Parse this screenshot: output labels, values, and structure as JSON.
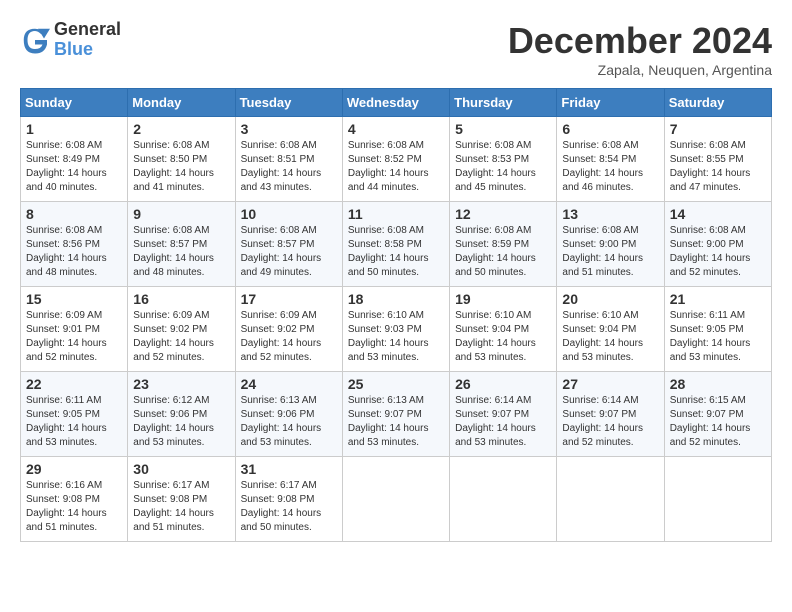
{
  "header": {
    "logo_line1": "General",
    "logo_line2": "Blue",
    "month": "December 2024",
    "location": "Zapala, Neuquen, Argentina"
  },
  "weekdays": [
    "Sunday",
    "Monday",
    "Tuesday",
    "Wednesday",
    "Thursday",
    "Friday",
    "Saturday"
  ],
  "weeks": [
    [
      {
        "day": "1",
        "info": "Sunrise: 6:08 AM\nSunset: 8:49 PM\nDaylight: 14 hours\nand 40 minutes."
      },
      {
        "day": "2",
        "info": "Sunrise: 6:08 AM\nSunset: 8:50 PM\nDaylight: 14 hours\nand 41 minutes."
      },
      {
        "day": "3",
        "info": "Sunrise: 6:08 AM\nSunset: 8:51 PM\nDaylight: 14 hours\nand 43 minutes."
      },
      {
        "day": "4",
        "info": "Sunrise: 6:08 AM\nSunset: 8:52 PM\nDaylight: 14 hours\nand 44 minutes."
      },
      {
        "day": "5",
        "info": "Sunrise: 6:08 AM\nSunset: 8:53 PM\nDaylight: 14 hours\nand 45 minutes."
      },
      {
        "day": "6",
        "info": "Sunrise: 6:08 AM\nSunset: 8:54 PM\nDaylight: 14 hours\nand 46 minutes."
      },
      {
        "day": "7",
        "info": "Sunrise: 6:08 AM\nSunset: 8:55 PM\nDaylight: 14 hours\nand 47 minutes."
      }
    ],
    [
      {
        "day": "8",
        "info": "Sunrise: 6:08 AM\nSunset: 8:56 PM\nDaylight: 14 hours\nand 48 minutes."
      },
      {
        "day": "9",
        "info": "Sunrise: 6:08 AM\nSunset: 8:57 PM\nDaylight: 14 hours\nand 48 minutes."
      },
      {
        "day": "10",
        "info": "Sunrise: 6:08 AM\nSunset: 8:57 PM\nDaylight: 14 hours\nand 49 minutes."
      },
      {
        "day": "11",
        "info": "Sunrise: 6:08 AM\nSunset: 8:58 PM\nDaylight: 14 hours\nand 50 minutes."
      },
      {
        "day": "12",
        "info": "Sunrise: 6:08 AM\nSunset: 8:59 PM\nDaylight: 14 hours\nand 50 minutes."
      },
      {
        "day": "13",
        "info": "Sunrise: 6:08 AM\nSunset: 9:00 PM\nDaylight: 14 hours\nand 51 minutes."
      },
      {
        "day": "14",
        "info": "Sunrise: 6:08 AM\nSunset: 9:00 PM\nDaylight: 14 hours\nand 52 minutes."
      }
    ],
    [
      {
        "day": "15",
        "info": "Sunrise: 6:09 AM\nSunset: 9:01 PM\nDaylight: 14 hours\nand 52 minutes."
      },
      {
        "day": "16",
        "info": "Sunrise: 6:09 AM\nSunset: 9:02 PM\nDaylight: 14 hours\nand 52 minutes."
      },
      {
        "day": "17",
        "info": "Sunrise: 6:09 AM\nSunset: 9:02 PM\nDaylight: 14 hours\nand 52 minutes."
      },
      {
        "day": "18",
        "info": "Sunrise: 6:10 AM\nSunset: 9:03 PM\nDaylight: 14 hours\nand 53 minutes."
      },
      {
        "day": "19",
        "info": "Sunrise: 6:10 AM\nSunset: 9:04 PM\nDaylight: 14 hours\nand 53 minutes."
      },
      {
        "day": "20",
        "info": "Sunrise: 6:10 AM\nSunset: 9:04 PM\nDaylight: 14 hours\nand 53 minutes."
      },
      {
        "day": "21",
        "info": "Sunrise: 6:11 AM\nSunset: 9:05 PM\nDaylight: 14 hours\nand 53 minutes."
      }
    ],
    [
      {
        "day": "22",
        "info": "Sunrise: 6:11 AM\nSunset: 9:05 PM\nDaylight: 14 hours\nand 53 minutes."
      },
      {
        "day": "23",
        "info": "Sunrise: 6:12 AM\nSunset: 9:06 PM\nDaylight: 14 hours\nand 53 minutes."
      },
      {
        "day": "24",
        "info": "Sunrise: 6:13 AM\nSunset: 9:06 PM\nDaylight: 14 hours\nand 53 minutes."
      },
      {
        "day": "25",
        "info": "Sunrise: 6:13 AM\nSunset: 9:07 PM\nDaylight: 14 hours\nand 53 minutes."
      },
      {
        "day": "26",
        "info": "Sunrise: 6:14 AM\nSunset: 9:07 PM\nDaylight: 14 hours\nand 53 minutes."
      },
      {
        "day": "27",
        "info": "Sunrise: 6:14 AM\nSunset: 9:07 PM\nDaylight: 14 hours\nand 52 minutes."
      },
      {
        "day": "28",
        "info": "Sunrise: 6:15 AM\nSunset: 9:07 PM\nDaylight: 14 hours\nand 52 minutes."
      }
    ],
    [
      {
        "day": "29",
        "info": "Sunrise: 6:16 AM\nSunset: 9:08 PM\nDaylight: 14 hours\nand 51 minutes."
      },
      {
        "day": "30",
        "info": "Sunrise: 6:17 AM\nSunset: 9:08 PM\nDaylight: 14 hours\nand 51 minutes."
      },
      {
        "day": "31",
        "info": "Sunrise: 6:17 AM\nSunset: 9:08 PM\nDaylight: 14 hours\nand 50 minutes."
      },
      {
        "day": "",
        "info": ""
      },
      {
        "day": "",
        "info": ""
      },
      {
        "day": "",
        "info": ""
      },
      {
        "day": "",
        "info": ""
      }
    ]
  ]
}
